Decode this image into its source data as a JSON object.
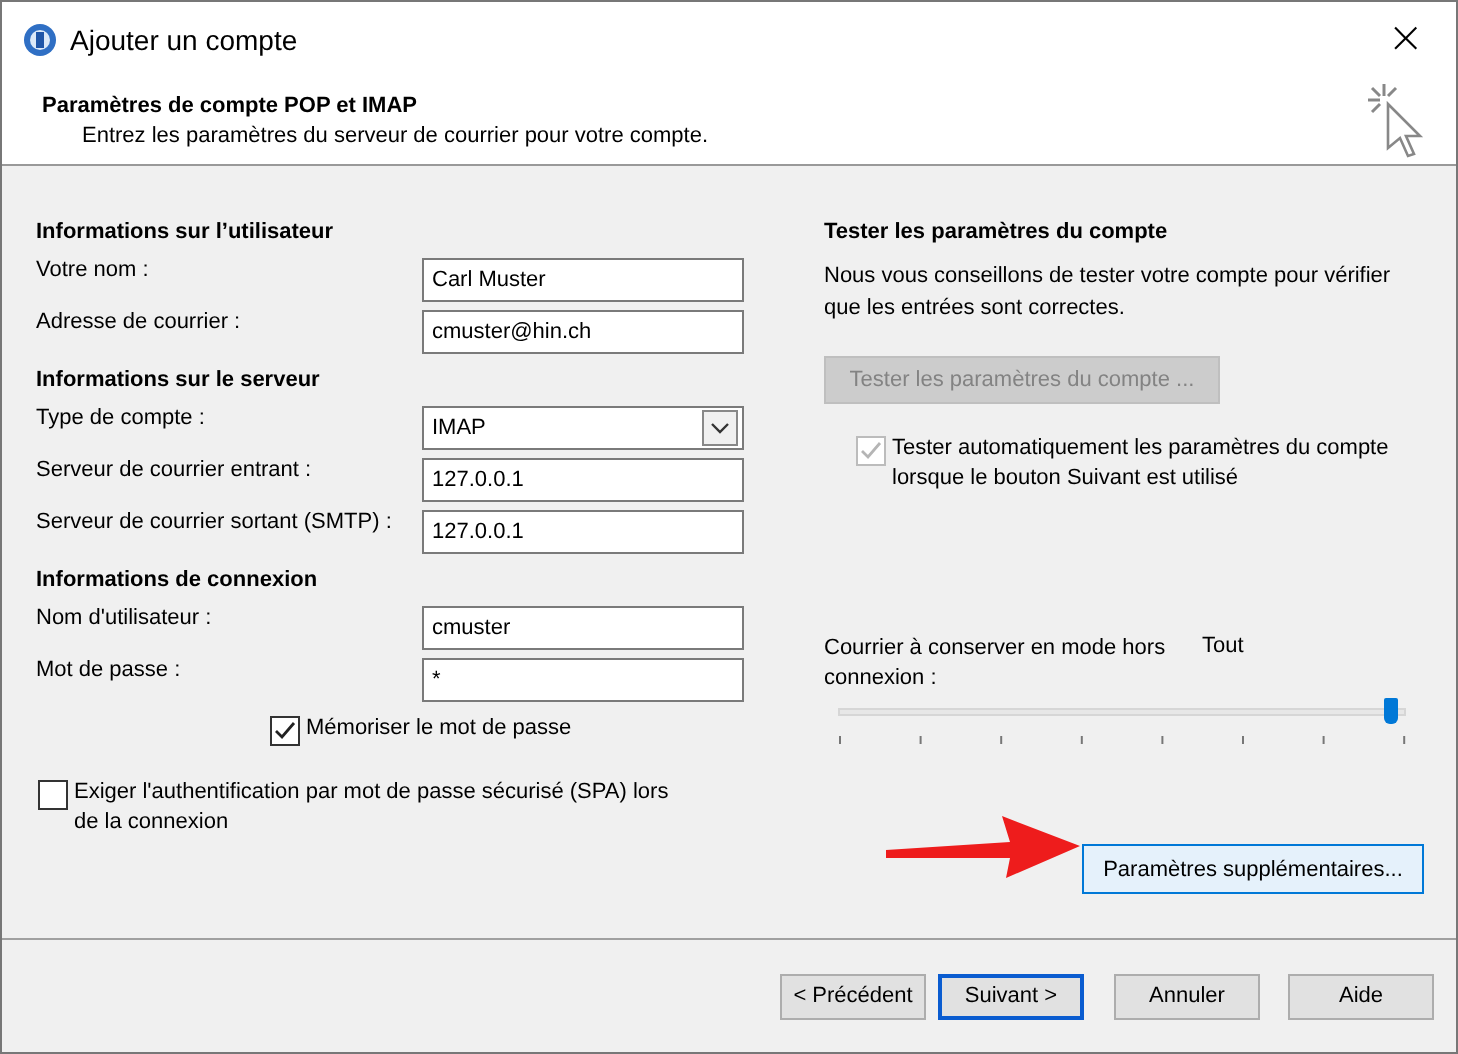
{
  "window": {
    "title": "Ajouter un compte",
    "close": "×"
  },
  "header": {
    "title": "Paramètres de compte POP et IMAP",
    "subtitle": "Entrez les paramètres du serveur de courrier pour votre compte."
  },
  "left": {
    "sections": [
      {
        "heading": "Informations sur l’utilisateur",
        "fields": [
          {
            "kind": "text",
            "label": "Votre nom :",
            "value": "Carl Muster"
          },
          {
            "kind": "text",
            "label": "Adresse de courrier :",
            "value": "cmuster@hin.ch"
          }
        ]
      },
      {
        "heading": "Informations sur le serveur",
        "fields": [
          {
            "kind": "select",
            "label": "Type de compte :",
            "value": "IMAP"
          },
          {
            "kind": "text",
            "label": "Serveur de courrier entrant :",
            "value": "127.0.0.1"
          },
          {
            "kind": "text",
            "label": "Serveur de courrier sortant (SMTP) :",
            "value": "127.0.0.1"
          }
        ]
      },
      {
        "heading": "Informations de connexion",
        "fields": [
          {
            "kind": "text",
            "label": "Nom d'utilisateur :",
            "value": "cmuster"
          },
          {
            "kind": "password",
            "label": "Mot de passe :",
            "value": "*"
          }
        ]
      }
    ],
    "remember": {
      "label": "Mémoriser le mot de passe",
      "checked": true
    },
    "spa": {
      "label": "Exiger l'authentification par mot de passe sécurisé (SPA) lors de la connexion",
      "checked": false
    }
  },
  "right": {
    "heading": "Tester les paramètres du compte",
    "text": "Nous vous conseillons de tester votre compte pour vérifier que les entrées sont correctes.",
    "test_button": {
      "label": "Tester les paramètres du compte ...",
      "disabled": true
    },
    "auto_test": {
      "label": "Tester automatiquement les paramètres du compte lorsque le bouton Suivant est utilisé",
      "checked": true,
      "disabled": true
    },
    "offline": {
      "label": "Courrier à conserver en mode hors connexion :",
      "reading": "Tout",
      "level": 1
    },
    "more_button": {
      "label": "Paramètres supplémentaires..."
    }
  },
  "footer": {
    "buttons": [
      {
        "label": "< Précédent",
        "default": false
      },
      {
        "label": "Suivant >",
        "default": true
      },
      {
        "label": "Annuler",
        "default": false
      },
      {
        "label": "Aide",
        "default": false
      }
    ]
  }
}
